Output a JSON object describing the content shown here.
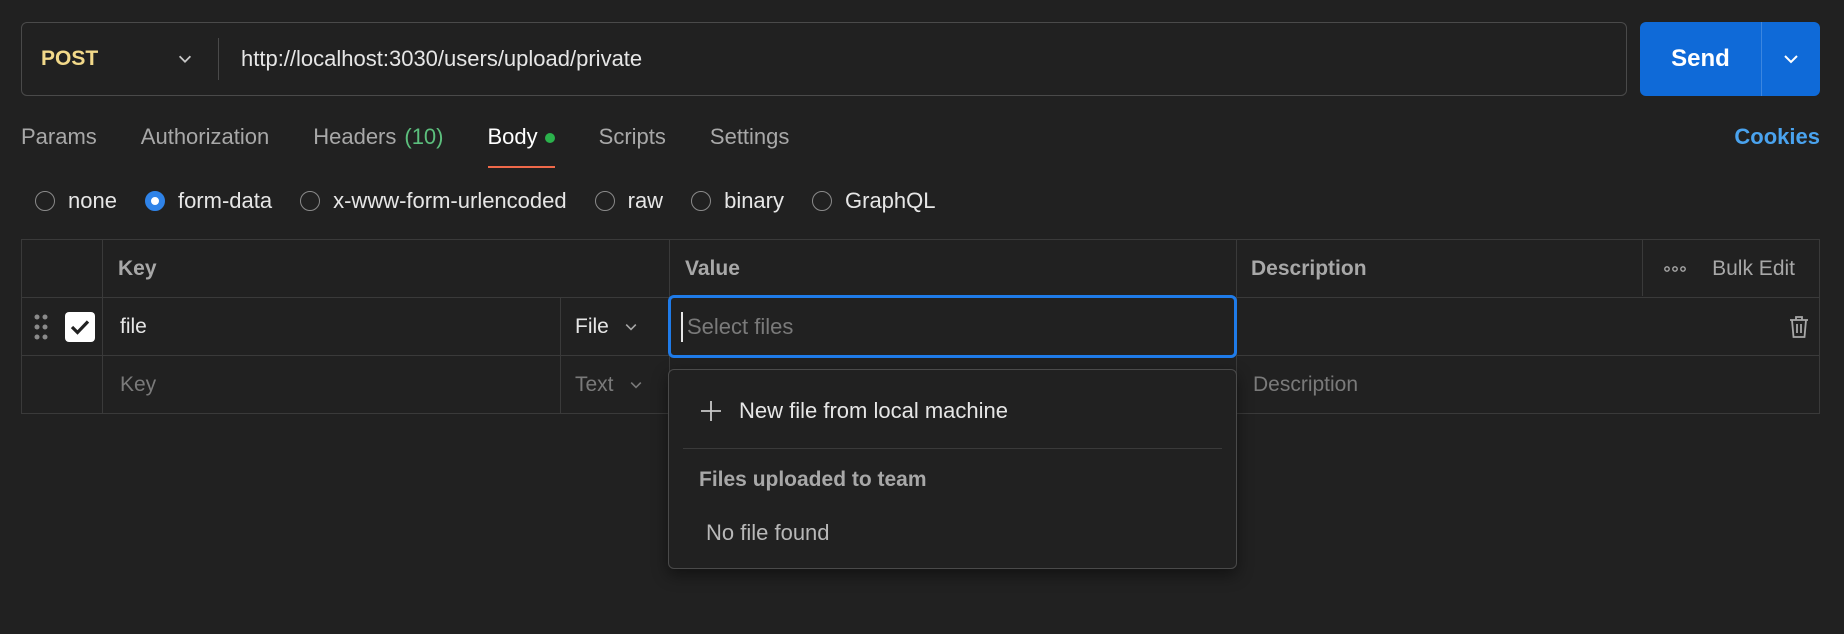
{
  "request": {
    "method": "POST",
    "url": "http://localhost:3030/users/upload/private",
    "send_label": "Send"
  },
  "tabs": [
    {
      "label": "Params"
    },
    {
      "label": "Authorization"
    },
    {
      "label": "Headers",
      "count": "(10)"
    },
    {
      "label": "Body",
      "active": true
    },
    {
      "label": "Scripts"
    },
    {
      "label": "Settings"
    }
  ],
  "cookies_label": "Cookies",
  "body_types": [
    {
      "label": "none",
      "checked": false
    },
    {
      "label": "form-data",
      "checked": true
    },
    {
      "label": "x-www-form-urlencoded",
      "checked": false
    },
    {
      "label": "raw",
      "checked": false
    },
    {
      "label": "binary",
      "checked": false
    },
    {
      "label": "GraphQL",
      "checked": false
    }
  ],
  "table": {
    "headers": {
      "key": "Key",
      "value": "Value",
      "description": "Description",
      "bulk_edit": "Bulk Edit"
    },
    "row1": {
      "key": "file",
      "type": "File",
      "value_placeholder": "Select files"
    },
    "row2": {
      "key_placeholder": "Key",
      "type": "Text",
      "description_placeholder": "Description"
    }
  },
  "dropdown": {
    "new_file": "New file from local machine",
    "section_title": "Files uploaded to team",
    "empty_text": "No file found"
  },
  "colors": {
    "accent": "#0f6ad8",
    "method": "#f2d98a",
    "active_tab_underline": "#f0694a",
    "body_dot": "#2bb24c",
    "headers_count": "#5cbf7d",
    "cookies": "#4aa3ee"
  }
}
